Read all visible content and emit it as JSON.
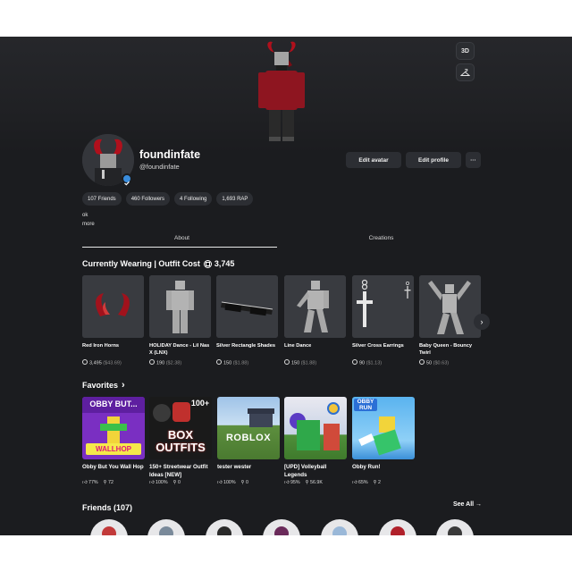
{
  "profile": {
    "display_name": "foundinfate",
    "username": "@foundinfate",
    "bio": "ok",
    "more_label": "more"
  },
  "hero": {
    "view_3d_label": "3D",
    "outfit_icon": "hanger-icon"
  },
  "actions": {
    "edit_avatar": "Edit avatar",
    "edit_profile": "Edit profile",
    "more": "···"
  },
  "stats": [
    {
      "label": "107 Friends"
    },
    {
      "label": "460 Followers"
    },
    {
      "label": "4 Following"
    },
    {
      "label": "1,693 RAP"
    }
  ],
  "tabs": [
    {
      "label": "About"
    },
    {
      "label": "Creations"
    }
  ],
  "wearing": {
    "title": "Currently Wearing | Outfit Cost",
    "cost": "3,745",
    "items": [
      {
        "name": "Red Iron Horns",
        "price": "3,495",
        "orig": "($43.69)"
      },
      {
        "name": "HOLIDAY Dance - Lil Nas X (LNX)",
        "price": "190",
        "orig": "($2.38)"
      },
      {
        "name": "Silver Rectangle Shades",
        "price": "150",
        "orig": "($1.88)"
      },
      {
        "name": "Line Dance",
        "price": "150",
        "orig": "($1.88)"
      },
      {
        "name": "Silver Cross Earrings",
        "price": "90",
        "orig": "($1.13)"
      },
      {
        "name": "Baby Queen - Bouncy Twirl",
        "price": "50",
        "orig": "($0.63)"
      }
    ]
  },
  "favorites": {
    "title": "Favorites",
    "chevron": "›",
    "items": [
      {
        "name": "Obby But You Wall Hop",
        "rating": "77%",
        "players": "72",
        "thumb_top": "OBBY BUT...",
        "thumb_bottom": "WALLHOP"
      },
      {
        "name": "150+ Streetwear Outfit Ideas [NEW]",
        "rating": "100%",
        "players": "0",
        "thumb_top": "100+",
        "thumb_bottom": "BOX OUTFITS"
      },
      {
        "name": "tester wester",
        "rating": "100%",
        "players": "0",
        "thumb_top": "",
        "thumb_bottom": "ROBLOX"
      },
      {
        "name": "[UPD] Volleyball Legends",
        "rating": "95%",
        "players": "56.9K",
        "thumb_top": "",
        "thumb_bottom": ""
      },
      {
        "name": "Obby Run!",
        "rating": "65%",
        "players": "2",
        "thumb_top": "OBBY RUN",
        "thumb_bottom": ""
      }
    ]
  },
  "friends": {
    "title": "Friends (107)",
    "see_all": "See All →"
  },
  "colors": {
    "background": "#1b1c1f",
    "card": "#393b40",
    "pill": "#2c2e33",
    "verified": "#3a8ddd",
    "accent_red": "#a31621"
  }
}
